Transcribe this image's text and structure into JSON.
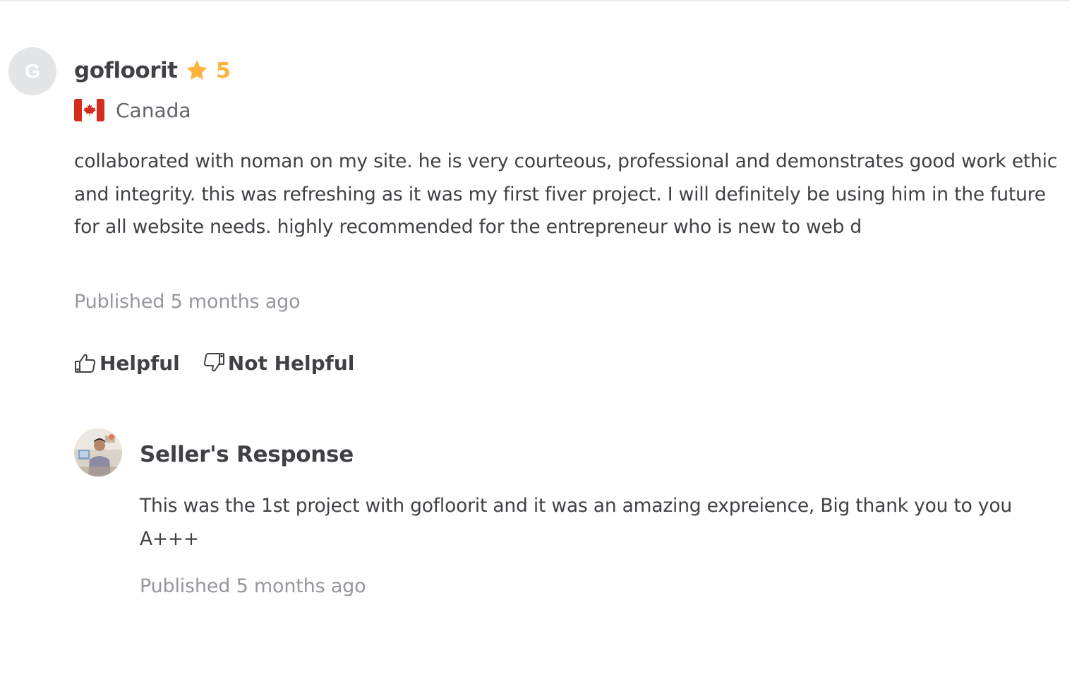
{
  "review": {
    "avatar_letter": "G",
    "username": "gofloorit",
    "rating": "5",
    "country": "Canada",
    "text": "collaborated with noman on my site. he is very courteous, professional and demonstrates good work ethic and integrity. this was refreshing as it was my first fiver project. I will definitely be using him in the future for all website needs. highly recommended for the entrepreneur who is new to web d",
    "published": "Published 5 months ago",
    "icons": {
      "rating": "star-icon",
      "country": "canada-flag-icon",
      "helpful": "thumbs-up-icon",
      "not_helpful": "thumbs-down-icon"
    }
  },
  "actions": {
    "helpful_label": "Helpful",
    "not_helpful_label": "Not Helpful"
  },
  "seller_response": {
    "title": "Seller's Response",
    "text": "This was the 1st project with gofloorit and it was an amazing expreience, Big thank you to you A+++",
    "published": "Published 5 months ago"
  },
  "colors": {
    "text": "#404145",
    "muted": "#95979d",
    "star": "#ffb33e",
    "avatar_bg": "#e4e5e7"
  }
}
